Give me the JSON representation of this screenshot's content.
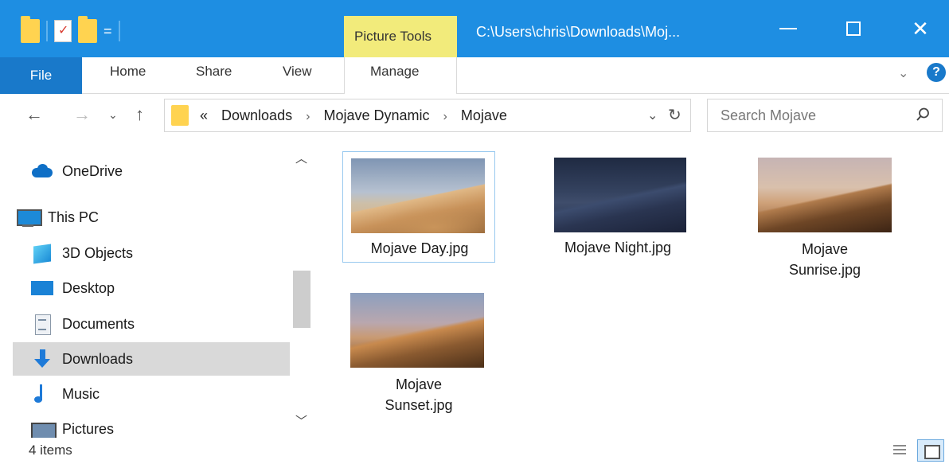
{
  "window": {
    "context_tab": "Picture Tools",
    "title": "C:\\Users\\chris\\Downloads\\Moj..."
  },
  "ribbon": {
    "tabs": [
      "File",
      "Home",
      "Share",
      "View",
      "Manage"
    ]
  },
  "address": {
    "overflow": "«",
    "crumbs": [
      "Downloads",
      "Mojave Dynamic",
      "Mojave"
    ],
    "search_placeholder": "Search Mojave"
  },
  "nav_pane": {
    "items": [
      {
        "label": "OneDrive",
        "icon": "onedrive-icon"
      },
      {
        "label": "This PC",
        "icon": "this-pc-icon"
      },
      {
        "label": "3D Objects",
        "icon": "3d-objects-icon"
      },
      {
        "label": "Desktop",
        "icon": "desktop-icon"
      },
      {
        "label": "Documents",
        "icon": "documents-icon"
      },
      {
        "label": "Downloads",
        "icon": "downloads-icon",
        "selected": true
      },
      {
        "label": "Music",
        "icon": "music-icon"
      },
      {
        "label": "Pictures",
        "icon": "pictures-icon"
      }
    ]
  },
  "files": [
    {
      "line1": "Mojave Day.jpg",
      "line2": "",
      "selected": true
    },
    {
      "line1": "Mojave Night.jpg",
      "line2": ""
    },
    {
      "line1": "Mojave",
      "line2": "Sunrise.jpg"
    },
    {
      "line1": "Mojave",
      "line2": "Sunset.jpg"
    }
  ],
  "status": {
    "item_count": "4 items"
  },
  "colors": {
    "titlebar": "#1e8ee2",
    "file_tab": "#1979ca",
    "picture_tools": "#f2eb7b",
    "selection": "#d9d9d9"
  }
}
